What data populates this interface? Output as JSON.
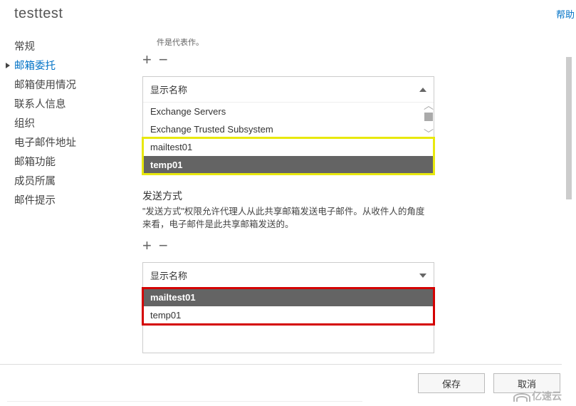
{
  "title": "testtest",
  "help": "帮助",
  "sidebar": {
    "items": [
      {
        "label": "常规"
      },
      {
        "label": "邮箱委托"
      },
      {
        "label": "邮箱使用情况"
      },
      {
        "label": "联系人信息"
      },
      {
        "label": "组织"
      },
      {
        "label": "电子邮件地址"
      },
      {
        "label": "邮箱功能"
      },
      {
        "label": "成员所属"
      },
      {
        "label": "邮件提示"
      }
    ],
    "selected_index": 1
  },
  "section1": {
    "truncated_hint": "件是代表作。",
    "header": "显示名称",
    "rows": [
      {
        "label": "Exchange Servers"
      },
      {
        "label": "Exchange Trusted Subsystem"
      },
      {
        "label": "mailtest01"
      },
      {
        "label": "temp01"
      }
    ],
    "selected_index": 3
  },
  "section2": {
    "title": "发送方式",
    "desc": "\"发送方式\"权限允许代理人从此共享邮箱发送电子邮件。从收件人的角度来看，电子邮件是此共享邮箱发送的。",
    "header": "显示名称",
    "rows": [
      {
        "label": "mailtest01"
      },
      {
        "label": "temp01"
      }
    ],
    "selected_index": 0
  },
  "buttons": {
    "add": "+",
    "remove": "−",
    "save": "保存",
    "cancel": "取消"
  },
  "watermark": "亿速云"
}
